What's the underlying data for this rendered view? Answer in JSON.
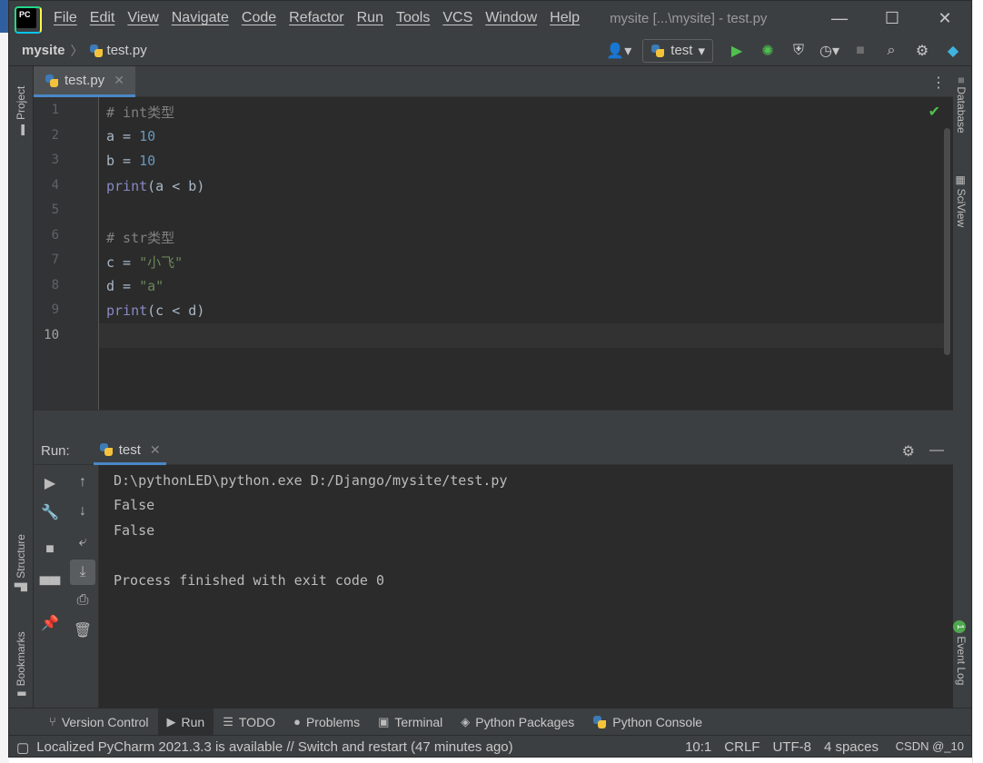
{
  "window": {
    "title": "mysite [...\\mysite] - test.py",
    "menu": [
      "File",
      "Edit",
      "View",
      "Navigate",
      "Code",
      "Refactor",
      "Run",
      "Tools",
      "VCS",
      "Window",
      "Help"
    ],
    "controls": [
      "—",
      "☐",
      "✕"
    ]
  },
  "navbar": {
    "root": "mysite",
    "file": "test.py",
    "run_config": "test"
  },
  "left_strip": {
    "project": "Project",
    "structure": "Structure",
    "bookmarks": "Bookmarks"
  },
  "right_strip": {
    "database": "Database",
    "sciview": "SciView",
    "event_log": "Event Log",
    "event_count": "1"
  },
  "editor": {
    "tab_label": "test.py",
    "line_numbers": [
      "1",
      "2",
      "3",
      "4",
      "5",
      "6",
      "7",
      "8",
      "9",
      "10"
    ],
    "lines": {
      "l1_comment": "# int类型",
      "l2_var": "a",
      "l2_eq": " = ",
      "l2_num": "10",
      "l3_var": "b",
      "l3_eq": " = ",
      "l3_num": "10",
      "l4_fn": "print",
      "l4_args": "(a < b)",
      "l6_comment": "# str类型",
      "l7_var": "c",
      "l7_eq": " = ",
      "l7_str": "\"小飞\"",
      "l8_var": "d",
      "l8_eq": " = ",
      "l8_str": "\"a\"",
      "l9_fn": "print",
      "l9_args": "(c < d)"
    }
  },
  "run": {
    "label": "Run:",
    "tab": "test",
    "output": [
      "D:\\pythonLED\\python.exe D:/Django/mysite/test.py",
      "False",
      "False",
      "",
      "Process finished with exit code 0"
    ]
  },
  "bottom_tabs": [
    "Version Control",
    "Run",
    "TODO",
    "Problems",
    "Terminal",
    "Python Packages",
    "Python Console"
  ],
  "status": {
    "message": "Localized PyCharm 2021.3.3 is available // Switch and restart (47 minutes ago)",
    "position": "10:1",
    "line_sep": "CRLF",
    "encoding": "UTF-8",
    "indent": "4 spaces"
  },
  "watermark": "CSDN @_10"
}
